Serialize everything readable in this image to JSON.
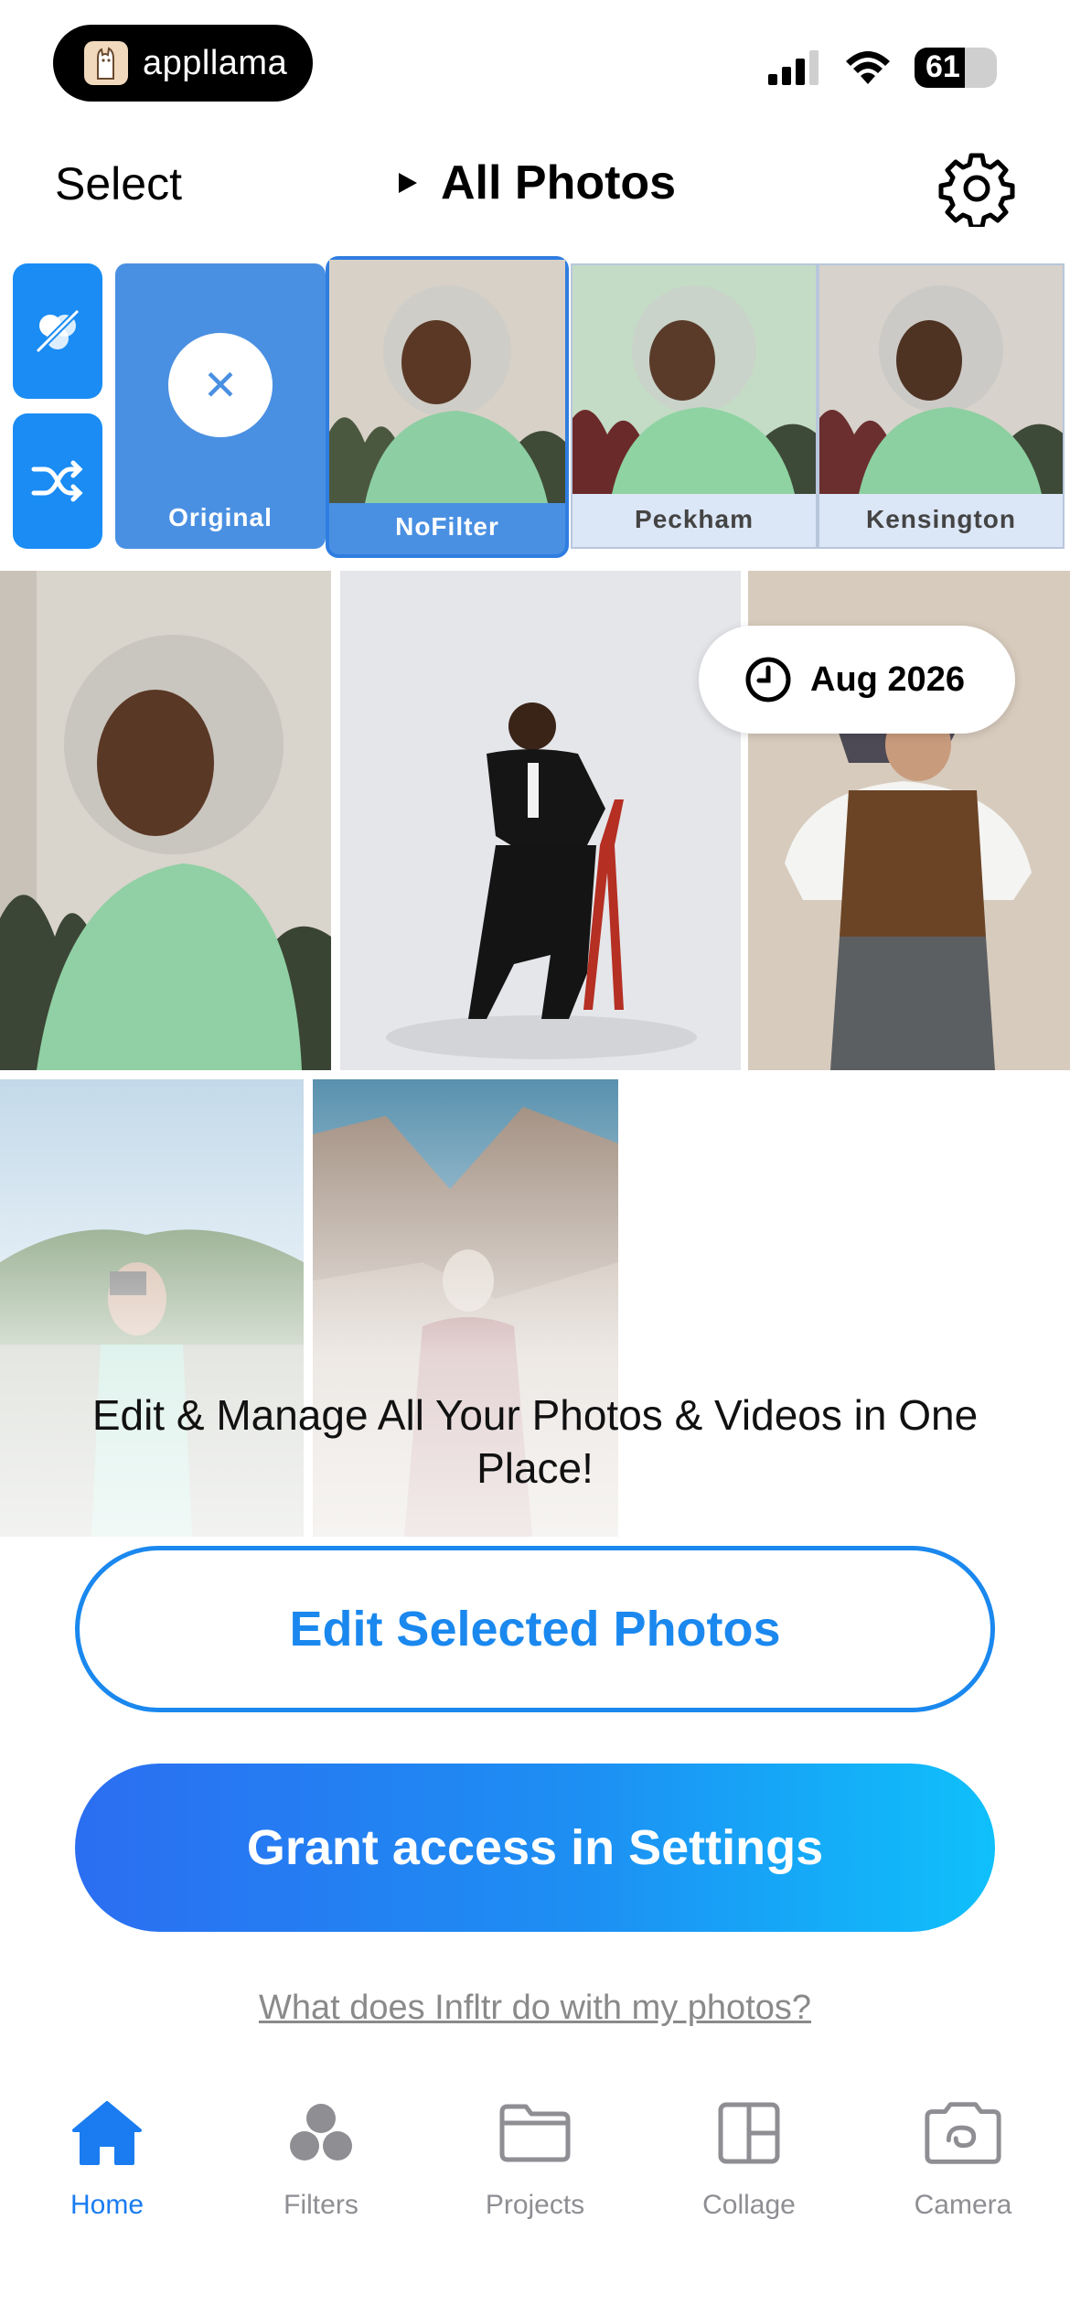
{
  "status_bar": {
    "brand": "appllama",
    "battery": "61"
  },
  "header": {
    "select_label": "Select",
    "title": "All Photos"
  },
  "filters": [
    {
      "label": "Original"
    },
    {
      "label": "NoFilter"
    },
    {
      "label": "Peckham"
    },
    {
      "label": "Kensington"
    }
  ],
  "grid": {
    "date_chip": "Aug 2026"
  },
  "message": {
    "headline": "Edit & Manage All Your Photos & Videos in One Place!"
  },
  "actions": {
    "edit_selected": "Edit Selected Photos",
    "grant_access": "Grant access in Settings",
    "help_link": "What does Infltr do with my photos?"
  },
  "tabs": [
    {
      "label": "Home",
      "icon": "home-icon",
      "active": true
    },
    {
      "label": "Filters",
      "icon": "filters-icon"
    },
    {
      "label": "Projects",
      "icon": "folder-icon"
    },
    {
      "label": "Collage",
      "icon": "collage-icon"
    },
    {
      "label": "Camera",
      "icon": "camera-icon"
    }
  ],
  "colors": {
    "accent": "#1a88ee",
    "filter_tile": "#4a90e2",
    "tab_inactive": "#8e8e93"
  }
}
